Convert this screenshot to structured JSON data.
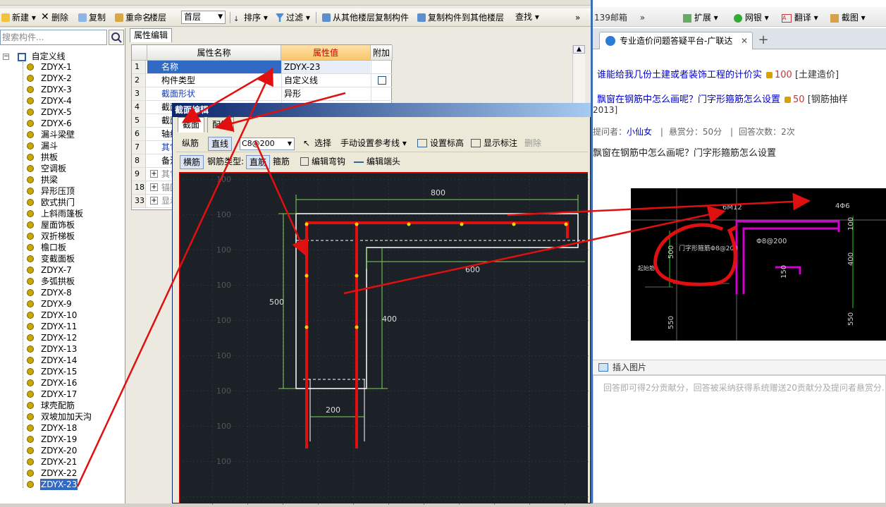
{
  "toolbar": {
    "items": [
      "新建",
      "删除",
      "复制",
      "重命名",
      "楼层",
      "排序",
      "过滤",
      "从其他楼层复制构件",
      "复制构件到其他楼层",
      "查找"
    ],
    "floor_value": "首层"
  },
  "left": {
    "search_placeholder": "搜索构件...",
    "root_label": "自定义线",
    "items": [
      "ZDYX-1",
      "ZDYX-2",
      "ZDYX-3",
      "ZDYX-4",
      "ZDYX-5",
      "ZDYX-6",
      "漏斗梁壁",
      "漏斗",
      "拱板",
      "空调板",
      "拱梁",
      "异形压顶",
      "欧式拱门",
      "上斜雨篷板",
      "屋面饰板",
      "双折梯板",
      "檐口板",
      "变截面板",
      "ZDYX-7",
      "多弧拱板",
      "ZDYX-8",
      "ZDYX-9",
      "ZDYX-10",
      "ZDYX-11",
      "ZDYX-12",
      "ZDYX-13",
      "ZDYX-14",
      "ZDYX-15",
      "ZDYX-16",
      "ZDYX-17",
      "球壳配筋",
      "双坡加加天沟",
      "ZDYX-18",
      "ZDYX-19",
      "ZDYX-20",
      "ZDYX-21",
      "ZDYX-22",
      "ZDYX-23"
    ]
  },
  "props": {
    "tab": "属性编辑",
    "headers": {
      "name": "属性名称",
      "value": "属性值",
      "extra": "附加"
    },
    "rows": [
      {
        "n": "1",
        "k": "名称",
        "v": "ZDYX-23"
      },
      {
        "n": "2",
        "k": "构件类型",
        "v": "自定义线"
      },
      {
        "n": "3",
        "k": "截面形状",
        "v": "异形"
      },
      {
        "n": "4",
        "k": "截面",
        "v": ""
      },
      {
        "n": "5",
        "k": "截面",
        "v": ""
      },
      {
        "n": "6",
        "k": "轴线",
        "v": ""
      },
      {
        "n": "7",
        "k": "其它",
        "v": ""
      },
      {
        "n": "8",
        "k": "备注",
        "v": ""
      },
      {
        "n": "9",
        "k": "其它",
        "v": ""
      },
      {
        "n": "18",
        "k": "锚固",
        "v": ""
      },
      {
        "n": "33",
        "k": "显示",
        "v": ""
      }
    ]
  },
  "dialog": {
    "title": "截面编辑",
    "tabs": [
      "截面",
      "配筋"
    ],
    "tb1": {
      "zongjin": "纵筋",
      "zhixian": "直线",
      "rebar": "C8@200",
      "select": "选择",
      "manual": "手动设置参考线",
      "set_elev": "设置标高",
      "show_dim": "显示标注",
      "delete": "删除"
    },
    "tb2": {
      "hengjin": "横筋",
      "rebar_type": "钢筋类型:",
      "zhijin": "直筋",
      "gujin": "箍筋",
      "edit_hook": "编辑弯钩",
      "edit_end": "编辑端头"
    },
    "canvas": {
      "grid_label": "100",
      "dims": {
        "top": "800",
        "inner": "600",
        "left": "500",
        "inner_v": "400",
        "bottom": "200"
      }
    }
  },
  "browser": {
    "nav": [
      "139邮箱",
      "扩展",
      "网银",
      "翻译",
      "截图"
    ],
    "tab_title": "专业造价问题答疑平台-广联达",
    "links": [
      {
        "text": "谁能给我几份土建或者装饰工程的计价实",
        "pts": "100",
        "tag": "[土建造价]"
      },
      {
        "text": "飘窗在钢筋中怎么画呢？门字形箍筋怎么设置",
        "pts": "50",
        "tag": "[钢筋抽样"
      },
      {
        "text": "2013]",
        "pts": "",
        "tag": ""
      }
    ],
    "meta": {
      "asker_label": "提问者：",
      "asker": "小仙女",
      "reward": "悬赏分：50分",
      "answers": "回答次数：2次"
    },
    "question": "飘窗在钢筋中怎么画呢？门字形箍筋怎么设置",
    "image_labels": {
      "l1": "4Φ6",
      "l2": "6M12",
      "l3": "门字形箍筋Φ8@200",
      "l4": "Φ8@200",
      "d1": "500",
      "d2": "550",
      "d3": "100",
      "d4": "400",
      "d5": "150",
      "d6": "550",
      "note": "起始筋"
    },
    "insert_image": "插入图片",
    "answer_placeholder": "回答即可得2分贡献分，回答被采纳获得系统赠送20贡献分及提问者悬赏分..."
  },
  "colors": {
    "red": "#e01010",
    "canvas_bg": "#1c2027",
    "dim_green": "#7fd45a",
    "title_blue": "#0a246a"
  }
}
